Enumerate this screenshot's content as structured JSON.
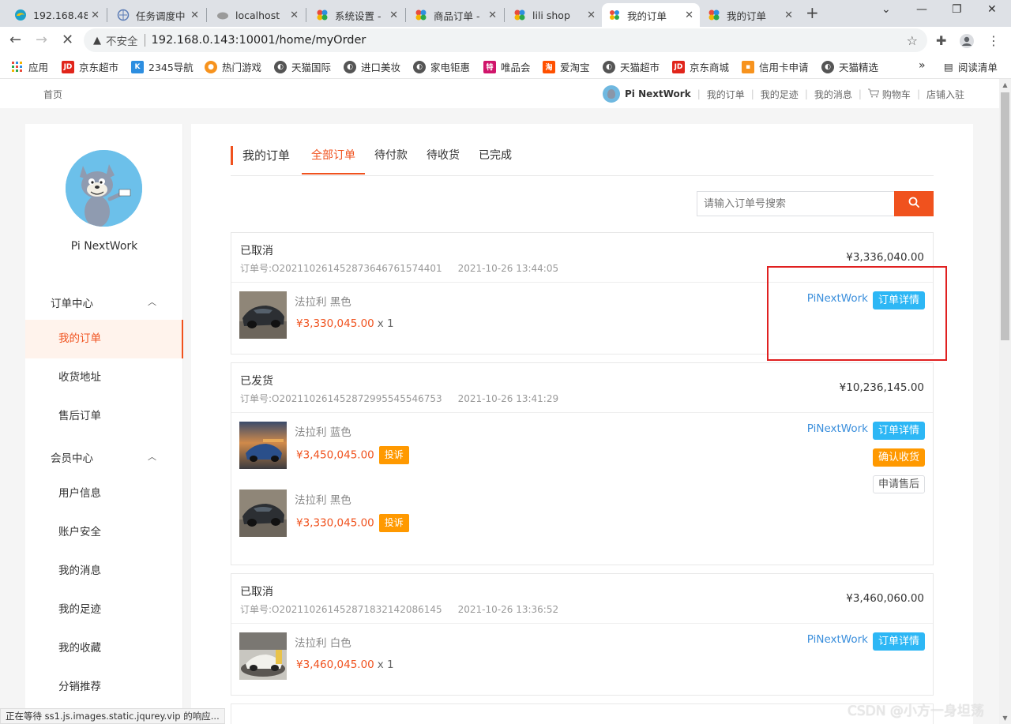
{
  "browser": {
    "tabs": [
      {
        "title": "192.168.48",
        "icon": "edge-icon"
      },
      {
        "title": "任务调度中",
        "icon": "globe-icon"
      },
      {
        "title": "localhost",
        "icon": "cloud-icon"
      },
      {
        "title": "系统设置 -",
        "icon": "pinwheel-icon"
      },
      {
        "title": "商品订单 -",
        "icon": "pinwheel-icon"
      },
      {
        "title": "lili shop",
        "icon": "pinwheel-icon"
      },
      {
        "title": "我的订单",
        "icon": "pinwheel-icon",
        "active": true
      },
      {
        "title": "我的订单",
        "icon": "pinwheel-icon"
      }
    ],
    "insecure_label": "不安全",
    "url": "192.168.0.143:10001/home/myOrder",
    "bookmarks": [
      {
        "label": "应用",
        "icon": "apps-grid-icon"
      },
      {
        "label": "京东超市",
        "icon": "jd-icon"
      },
      {
        "label": "2345导航",
        "icon": "k-icon"
      },
      {
        "label": "热门游戏",
        "icon": "game-icon"
      },
      {
        "label": "天猫国际",
        "icon": "globe-icon"
      },
      {
        "label": "进口美妆",
        "icon": "globe-icon"
      },
      {
        "label": "家电钜惠",
        "icon": "globe-icon"
      },
      {
        "label": "唯品会",
        "icon": "vip-icon"
      },
      {
        "label": "爱淘宝",
        "icon": "taobao-icon"
      },
      {
        "label": "天猫超市",
        "icon": "globe-icon"
      },
      {
        "label": "京东商城",
        "icon": "jd-icon"
      },
      {
        "label": "信用卡申请",
        "icon": "card-icon"
      },
      {
        "label": "天猫精选",
        "icon": "globe-icon"
      }
    ],
    "more_bookmarks": "»",
    "reading_list": "阅读清单",
    "status_text": "正在等待 ss1.js.images.static.jqurey.vip 的响应..."
  },
  "site": {
    "home": "首页",
    "username": "Pi NextWork",
    "nav": [
      "我的订单",
      "我的足迹",
      "我的消息",
      "购物车",
      "店铺入驻"
    ]
  },
  "sidebar": {
    "username": "Pi NextWork",
    "groups": [
      {
        "label": "订单中心",
        "items": [
          "我的订单",
          "收货地址",
          "售后订单"
        ]
      },
      {
        "label": "会员中心",
        "items": [
          "用户信息",
          "账户安全",
          "我的消息",
          "我的足迹",
          "我的收藏",
          "分销推荐"
        ]
      }
    ]
  },
  "main": {
    "headline": "我的订单",
    "tabs": [
      "全部订单",
      "待付款",
      "待收货",
      "已完成"
    ],
    "active_tab": "全部订单",
    "search_placeholder": "请输入订单号搜索",
    "orders": [
      {
        "status": "已取消",
        "order_no_label": "订单号:",
        "order_no": "O202110261452873646761574401",
        "date": "2021-10-26 13:44:05",
        "total": "¥3,336,040.00",
        "store": "PiNextWork",
        "detail_btn": "订单详情",
        "items": [
          {
            "name": "法拉利 黑色",
            "price": "¥3,330,045.00",
            "qty": "x 1"
          }
        ]
      },
      {
        "status": "已发货",
        "order_no_label": "订单号:",
        "order_no": "O202110261452872995545546753",
        "date": "2021-10-26 13:41:29",
        "total": "¥10,236,145.00",
        "store": "PiNextWork",
        "detail_btn": "订单详情",
        "confirm_btn": "确认收货",
        "aftersale_btn": "申请售后",
        "items": [
          {
            "name": "法拉利 蓝色",
            "price": "¥3,450,045.00",
            "complain": "投诉"
          },
          {
            "name": "法拉利 黑色",
            "price": "¥3,330,045.00",
            "complain": "投诉"
          }
        ]
      },
      {
        "status": "已取消",
        "order_no_label": "订单号:",
        "order_no": "O202110261452871832142086145",
        "date": "2021-10-26 13:36:52",
        "total": "¥3,460,060.00",
        "store": "PiNextWork",
        "detail_btn": "订单详情",
        "items": [
          {
            "name": "法拉利 白色",
            "price": "¥3,460,045.00",
            "qty": "x 1"
          }
        ]
      }
    ]
  },
  "watermark": "CSDN @小方一身坦荡",
  "colors": {
    "accent": "#f0521e",
    "detail_blue": "#2db7f5",
    "orange": "#ff9900",
    "link_blue": "#3b8fdc",
    "highlight_red": "#e02020"
  }
}
